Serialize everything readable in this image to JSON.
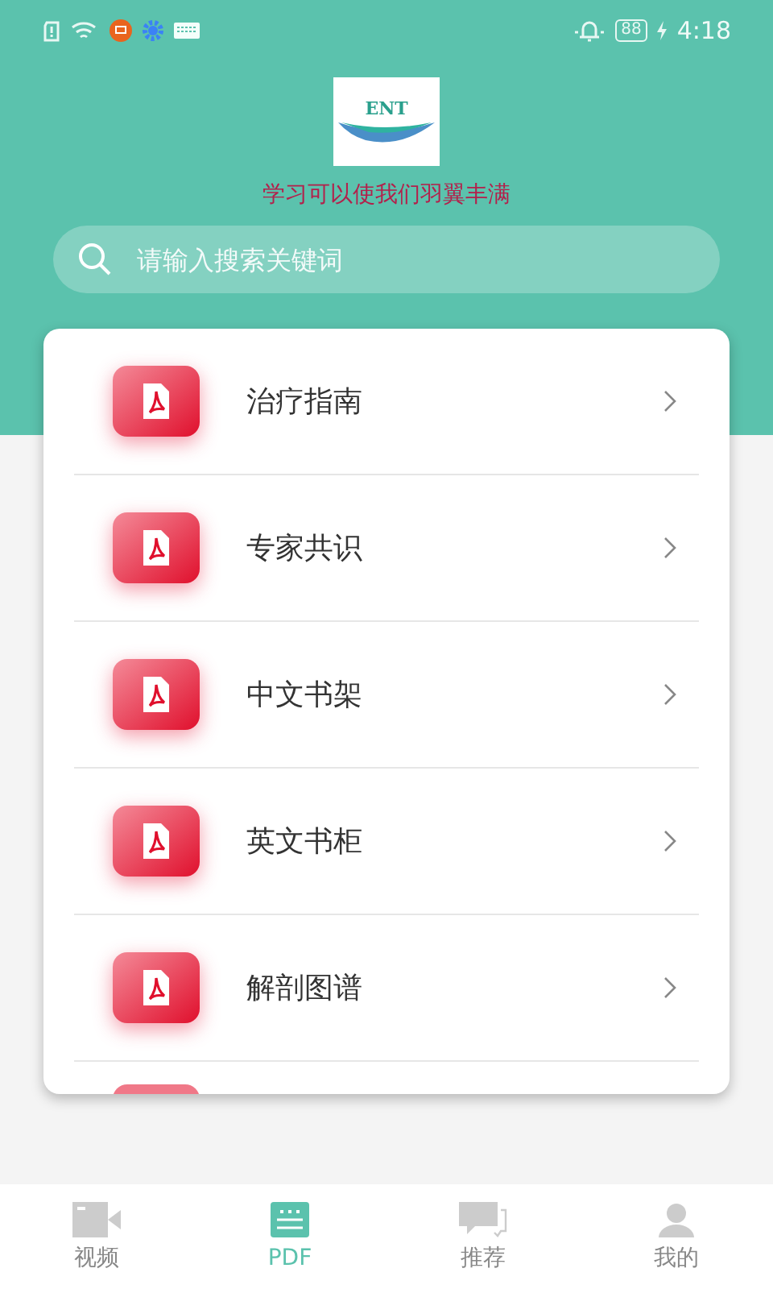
{
  "status_bar": {
    "battery": "88",
    "time": "4:18"
  },
  "header": {
    "logo": "ENT",
    "slogan": "学习可以使我们羽翼丰满"
  },
  "search": {
    "placeholder": "请输入搜索关键词"
  },
  "categories": [
    {
      "label": "治疗指南"
    },
    {
      "label": "专家共识"
    },
    {
      "label": "中文书架"
    },
    {
      "label": "英文书柜"
    },
    {
      "label": "解剖图谱"
    }
  ],
  "tabs": [
    {
      "label": "视频",
      "kind": "video",
      "selected": false
    },
    {
      "label": "PDF",
      "kind": "pdf",
      "selected": true
    },
    {
      "label": "推荐",
      "kind": "chat",
      "selected": false
    },
    {
      "label": "我的",
      "kind": "user",
      "selected": false
    }
  ]
}
